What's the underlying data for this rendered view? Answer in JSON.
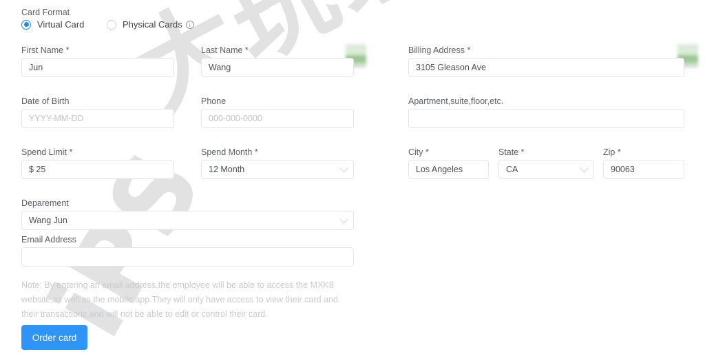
{
  "card_format": {
    "legend": "Card Format",
    "options": [
      {
        "label": "Virtual Card",
        "selected": true
      },
      {
        "label": "Physical Cards",
        "selected": false,
        "info_icon": "info-icon"
      }
    ]
  },
  "fields": {
    "first_name": {
      "label": "First Name *",
      "value": "Jun",
      "placeholder": ""
    },
    "last_name": {
      "label": "Last Name *",
      "value": "Wang",
      "placeholder": ""
    },
    "date_of_birth": {
      "label": "Date of Birth",
      "value": "",
      "placeholder": "YYYY-MM-DD"
    },
    "phone": {
      "label": "Phone",
      "value": "",
      "placeholder": "000-000-0000"
    },
    "spend_limit": {
      "label": "Spend Limit *",
      "value": "$ 25",
      "placeholder": ""
    },
    "spend_month": {
      "label": "Spend Month *",
      "value": "12 Month",
      "placeholder": ""
    },
    "department": {
      "label": "Deparement",
      "value": "Wang Jun",
      "placeholder": ""
    },
    "email": {
      "label": "Email Address",
      "value": "",
      "placeholder": ""
    },
    "billing_address": {
      "label": "Billing Address *",
      "value": "3105 Gleason Ave",
      "placeholder": ""
    },
    "apartment": {
      "label": "Apartment,suite,floor,etc.",
      "value": "",
      "placeholder": ""
    },
    "city": {
      "label": "City *",
      "value": "Los Angeles",
      "placeholder": ""
    },
    "state": {
      "label": "State *",
      "value": "CA",
      "placeholder": ""
    },
    "zip": {
      "label": "Zip *",
      "value": "90063",
      "placeholder": ""
    }
  },
  "note": "Note: By entering an email address,the employee will be able to access the MXK8 website,as well as the mobile app.They will only have access to view their card and their transactions,and will not be able to edit or control their card.",
  "submit": {
    "label": "Order card"
  },
  "watermark": {
    "cjk": "大玩家",
    "latin": "iPS"
  },
  "colors": {
    "accent": "#2f94f7",
    "radio_selected": "#2089ef",
    "label_text": "#5a6068",
    "value_text": "#4a4f55",
    "placeholder_text": "#bfc3c8",
    "field_border": "#e3e5e8",
    "note_text": "#c8ccd0",
    "redaction": "#9ec795"
  }
}
